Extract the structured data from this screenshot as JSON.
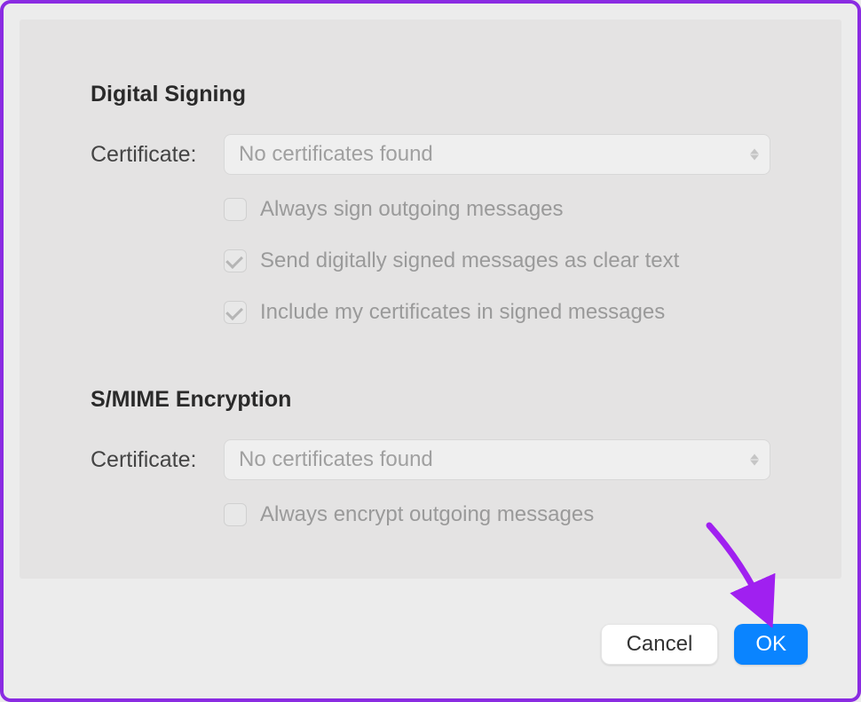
{
  "digitalSigning": {
    "title": "Digital Signing",
    "certificateLabel": "Certificate:",
    "certificatePlaceholder": "No certificates found",
    "options": {
      "alwaysSign": {
        "label": "Always sign outgoing messages",
        "checked": false
      },
      "clearText": {
        "label": "Send digitally signed messages as clear text",
        "checked": true
      },
      "includeCerts": {
        "label": "Include my certificates in signed messages",
        "checked": true
      }
    }
  },
  "smimeEncryption": {
    "title": "S/MIME Encryption",
    "certificateLabel": "Certificate:",
    "certificatePlaceholder": "No certificates found",
    "options": {
      "alwaysEncrypt": {
        "label": "Always encrypt outgoing messages",
        "checked": false
      }
    }
  },
  "buttons": {
    "cancel": "Cancel",
    "ok": "OK"
  }
}
